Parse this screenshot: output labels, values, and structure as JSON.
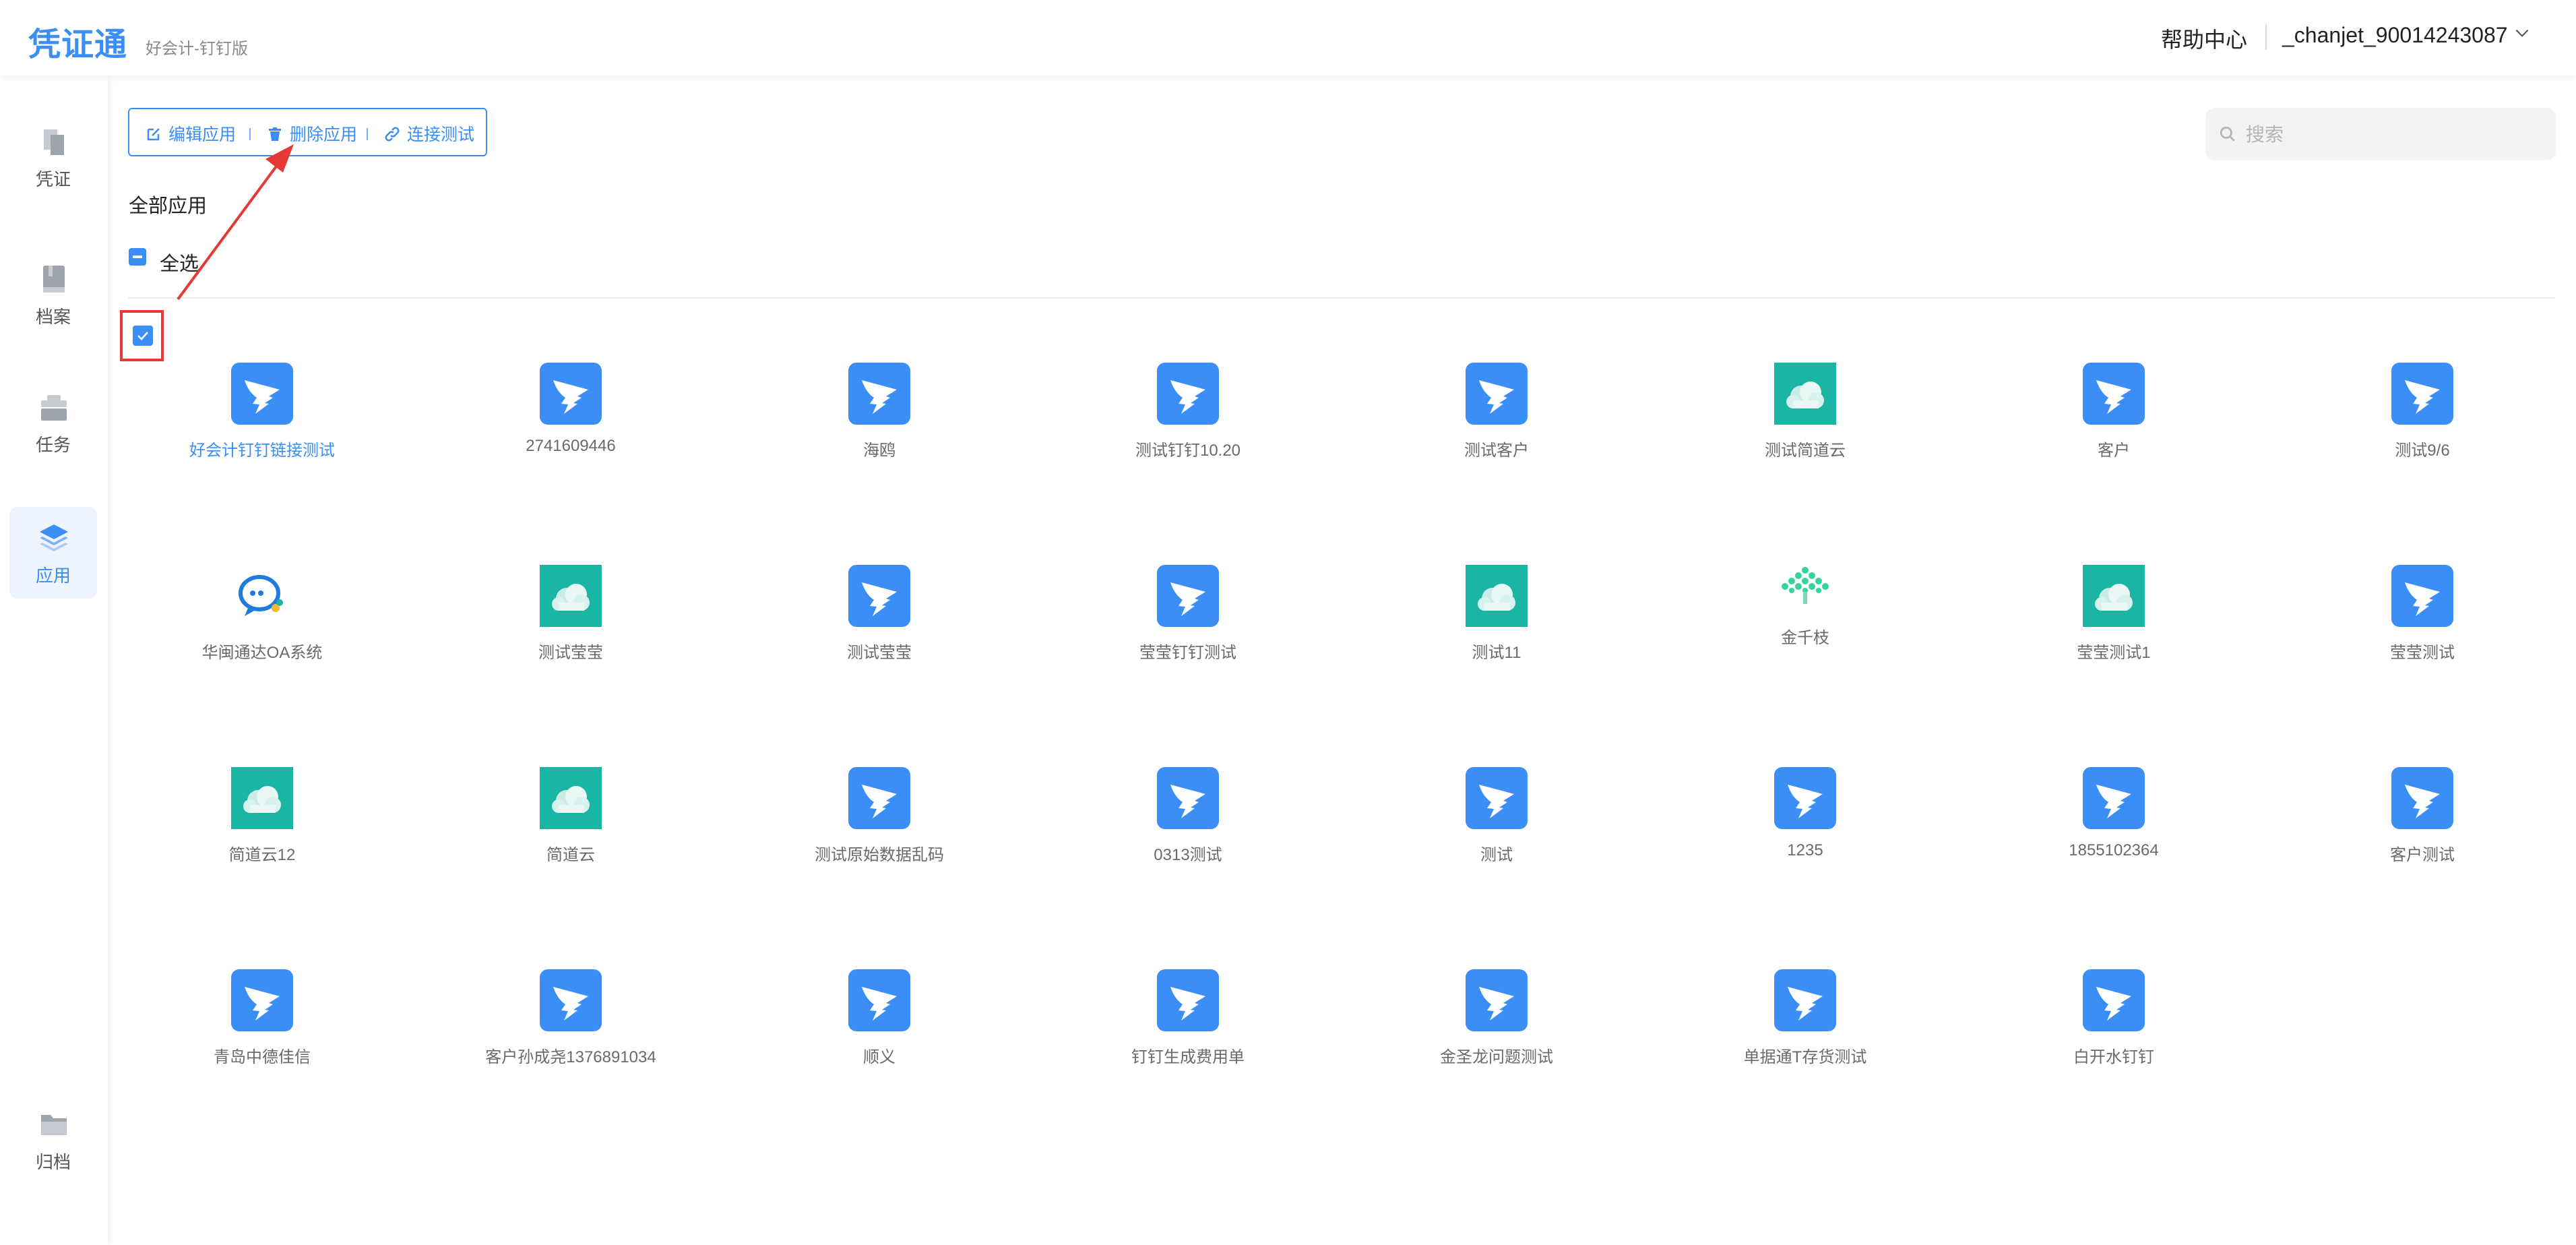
{
  "header": {
    "logo": "凭证通",
    "subtitle": "好会计-钉钉版",
    "help": "帮助中心",
    "user": "_chanjet_90014243087"
  },
  "sidebar": {
    "items": [
      {
        "label": "凭证",
        "icon": "voucher-icon"
      },
      {
        "label": "档案",
        "icon": "book-icon"
      },
      {
        "label": "任务",
        "icon": "task-icon"
      },
      {
        "label": "应用",
        "icon": "layers-icon",
        "active": true
      },
      {
        "label": "归档",
        "icon": "folder-icon"
      }
    ]
  },
  "toolbar": {
    "edit": "编辑应用",
    "delete": "删除应用",
    "test": "连接测试"
  },
  "search": {
    "placeholder": "搜索"
  },
  "section_title": "全部应用",
  "select_all": "全选",
  "colors": {
    "accent": "#3b8ef5",
    "teal": "#1bb5a5",
    "highlight": "#e53935"
  },
  "apps": [
    {
      "name": "好会计钉钉链接测试",
      "icon": "dingtalk",
      "selected": true
    },
    {
      "name": "2741609446",
      "icon": "dingtalk"
    },
    {
      "name": "海鸥",
      "icon": "dingtalk"
    },
    {
      "name": "测试钉钉10.20",
      "icon": "dingtalk"
    },
    {
      "name": "测试客户",
      "icon": "dingtalk"
    },
    {
      "name": "测试简道云",
      "icon": "cloud"
    },
    {
      "name": "客户",
      "icon": "dingtalk"
    },
    {
      "name": "测试9/6",
      "icon": "dingtalk"
    },
    {
      "name": "华闽通达OA系统",
      "icon": "chat"
    },
    {
      "name": "测试莹莹",
      "icon": "cloud"
    },
    {
      "name": "测试莹莹",
      "icon": "dingtalk"
    },
    {
      "name": "莹莹钉钉测试",
      "icon": "dingtalk"
    },
    {
      "name": "测试11",
      "icon": "cloud"
    },
    {
      "name": "金千枝",
      "icon": "tree"
    },
    {
      "name": "莹莹测试1",
      "icon": "cloud"
    },
    {
      "name": "莹莹测试",
      "icon": "dingtalk"
    },
    {
      "name": "简道云12",
      "icon": "cloud"
    },
    {
      "name": "简道云",
      "icon": "cloud"
    },
    {
      "name": "测试原始数据乱码",
      "icon": "dingtalk"
    },
    {
      "name": "0313测试",
      "icon": "dingtalk"
    },
    {
      "name": "测试",
      "icon": "dingtalk"
    },
    {
      "name": "1235",
      "icon": "dingtalk"
    },
    {
      "name": "1855102364",
      "icon": "dingtalk"
    },
    {
      "name": "客户测试",
      "icon": "dingtalk"
    },
    {
      "name": "青岛中德佳信",
      "icon": "dingtalk"
    },
    {
      "name": "客户孙成尧1376891034",
      "icon": "dingtalk"
    },
    {
      "name": "顺义",
      "icon": "dingtalk"
    },
    {
      "name": "钉钉生成费用单",
      "icon": "dingtalk"
    },
    {
      "name": "金圣龙问题测试",
      "icon": "dingtalk"
    },
    {
      "name": "单据通T存货测试",
      "icon": "dingtalk"
    },
    {
      "name": "白开水钉钉",
      "icon": "dingtalk"
    }
  ]
}
